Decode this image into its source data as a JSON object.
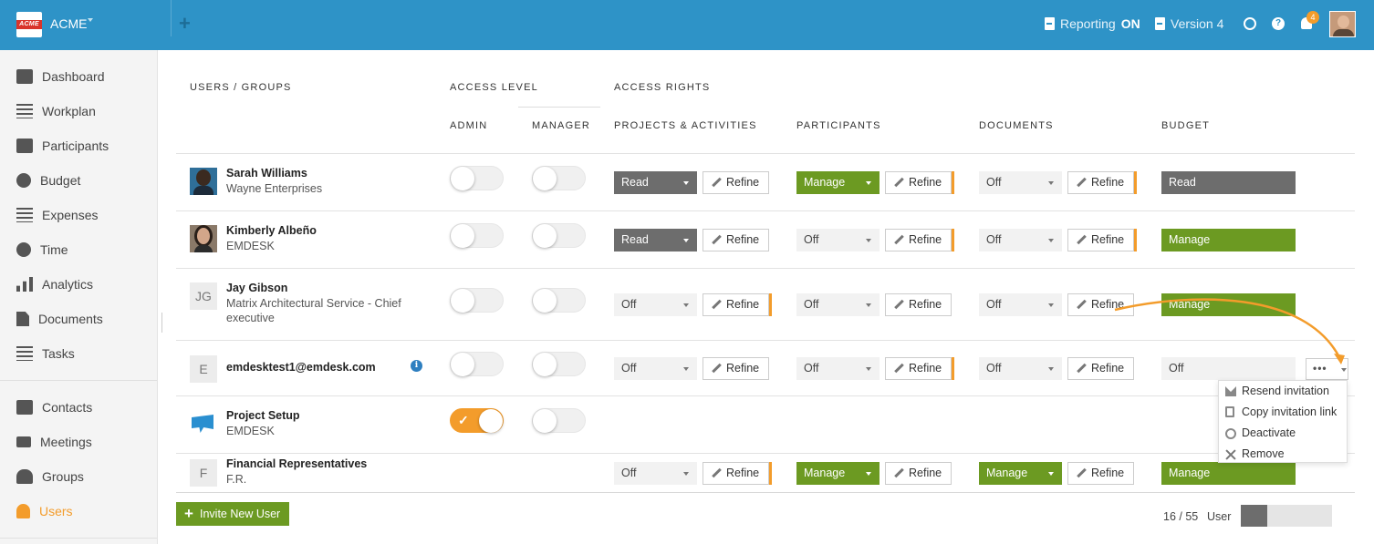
{
  "app": {
    "logo_text": "ACME",
    "name": "ACME",
    "reporting_label": "Reporting",
    "reporting_state": "ON",
    "version_label": "Version 4",
    "notification_count": "4"
  },
  "sidebar": {
    "items": [
      {
        "label": "Dashboard",
        "icon": "dashboard-icon"
      },
      {
        "label": "Workplan",
        "icon": "workplan-icon"
      },
      {
        "label": "Participants",
        "icon": "participants-icon"
      },
      {
        "label": "Budget",
        "icon": "budget-icon"
      },
      {
        "label": "Expenses",
        "icon": "expenses-icon"
      },
      {
        "label": "Time",
        "icon": "clock-icon"
      },
      {
        "label": "Analytics",
        "icon": "bar-chart-icon"
      },
      {
        "label": "Documents",
        "icon": "document-icon"
      },
      {
        "label": "Tasks",
        "icon": "list-icon"
      },
      {
        "label": "Contacts",
        "icon": "contacts-icon"
      },
      {
        "label": "Meetings",
        "icon": "camera-icon"
      },
      {
        "label": "Groups",
        "icon": "groups-icon"
      },
      {
        "label": "Users",
        "icon": "user-icon",
        "active": true
      }
    ]
  },
  "table": {
    "headers": {
      "users_groups": "USERS / GROUPS",
      "access_level": "ACCESS LEVEL",
      "access_rights": "ACCESS RIGHTS",
      "admin": "ADMIN",
      "manager": "MANAGER",
      "projects": "PROJECTS & ACTIVITIES",
      "participants": "PARTICIPANTS",
      "documents": "DOCUMENTS",
      "budget": "BUDGET"
    },
    "refine_label": "Refine",
    "rows": [
      {
        "name": "Sarah Williams",
        "org": "Wayne Enterprises",
        "admin": false,
        "manager": false,
        "projects": "Read",
        "participants": "Manage",
        "documents": "Off",
        "budget": "Read"
      },
      {
        "name": "Kimberly Albeño",
        "org": "EMDESK",
        "admin": false,
        "manager": false,
        "projects": "Read",
        "participants": "Off",
        "documents": "Off",
        "budget": "Manage"
      },
      {
        "name": "Jay Gibson",
        "initials": "JG",
        "org_line1": "Matrix Architectural Service - Chief",
        "org_line2": "executive",
        "admin": false,
        "manager": false,
        "projects": "Off",
        "participants": "Off",
        "documents": "Off",
        "budget": "Manage"
      },
      {
        "name": "emdesktest1@emdesk.com",
        "initials": "E",
        "info_icon": "i",
        "admin": false,
        "manager": false,
        "projects": "Off",
        "participants": "Off",
        "documents": "Off",
        "budget": "Off"
      },
      {
        "name": "Project Setup",
        "org": "EMDESK",
        "admin": true,
        "manager": false
      },
      {
        "name": "Financial Representatives",
        "initials": "F",
        "org": "F.R.",
        "projects": "Off",
        "participants": "Manage",
        "documents": "Manage",
        "budget": "Manage"
      }
    ]
  },
  "context_menu": {
    "dots": "•••",
    "items": [
      "Resend invitation",
      "Copy invitation link",
      "Deactivate",
      "Remove"
    ]
  },
  "footer": {
    "invite_label": "Invite New User",
    "user_count": "16 / 55",
    "user_label": "User",
    "usage_fraction": 0.29
  },
  "colors": {
    "topbar": "#2e93c7",
    "accent": "#f39c2b",
    "manage": "#6c9a22",
    "read": "#6d6d6d"
  }
}
